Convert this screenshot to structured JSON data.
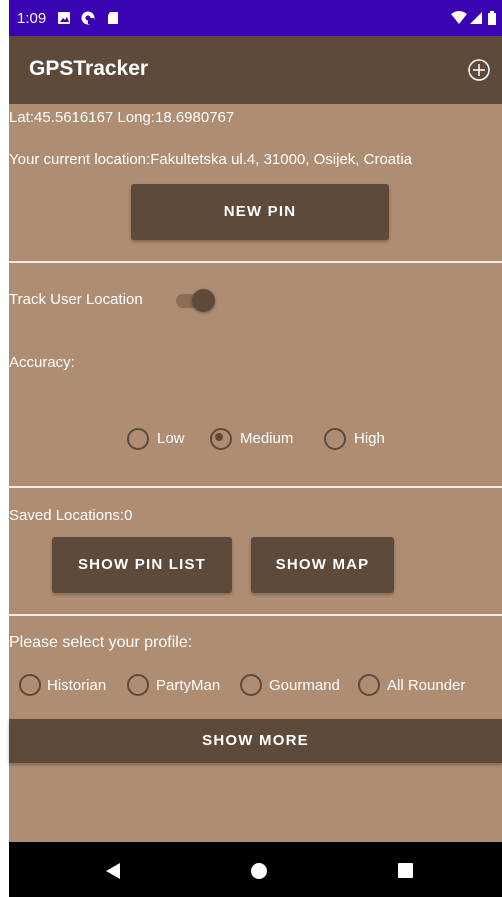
{
  "status_bar": {
    "time": "1:09",
    "icons": [
      "image-icon",
      "pocket-casts-icon",
      "sd-card-icon",
      "wifi-icon",
      "signal-icon",
      "battery-icon"
    ]
  },
  "app_bar": {
    "title": "GPSTracker",
    "add_icon": "add-circle-icon"
  },
  "location": {
    "coords": "Lat:45.5616167   Long:18.6980767",
    "address": "Your current location:Fakultetska ul.4, 31000, Osijek, Croatia",
    "new_pin_label": "NEW PIN"
  },
  "tracking": {
    "track_label": "Track User Location",
    "track_enabled": true,
    "accuracy_label": "Accuracy:",
    "accuracy_options": [
      "Low",
      "Medium",
      "High"
    ],
    "accuracy_selected": "Medium"
  },
  "saved": {
    "count_label": "Saved Locations:0",
    "show_pin_list_label": "SHOW PIN LIST",
    "show_map_label": "SHOW MAP"
  },
  "profile": {
    "prompt": "Please select your profile:",
    "options": [
      "Historian",
      "PartyMan",
      "Gourmand",
      "All Rounder"
    ],
    "selected": null,
    "show_more_label": "SHOW MORE"
  },
  "colors": {
    "status_bar": "#3a03b3",
    "app_bar": "#5d4a3a",
    "background": "#ae8d73",
    "button": "#5d4a3a",
    "nav_bar": "#000000"
  },
  "nav": {
    "icons": [
      "back-icon",
      "home-icon",
      "recents-icon"
    ]
  }
}
